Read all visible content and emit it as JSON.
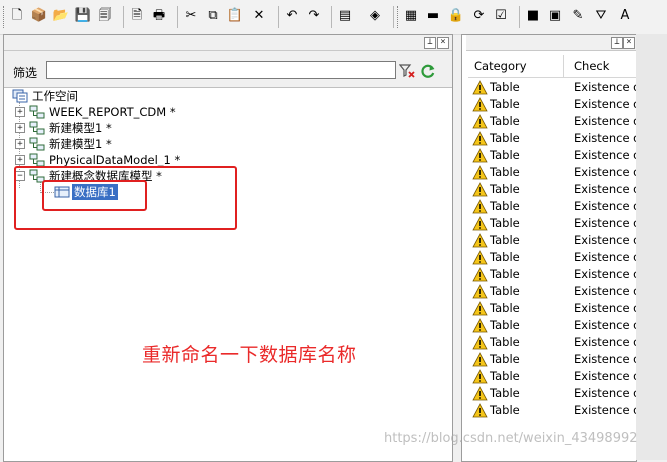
{
  "toolbar": {
    "buttons": [
      {
        "name": "new-icon",
        "glyph": "🗋"
      },
      {
        "name": "new-project-icon",
        "glyph": "📦"
      },
      {
        "name": "open-icon",
        "glyph": "📂"
      },
      {
        "name": "save-icon",
        "glyph": "💾"
      },
      {
        "name": "save-all-icon",
        "glyph": "🗐"
      },
      {
        "name": "print-preview-icon",
        "glyph": "🗎"
      },
      {
        "name": "print-icon",
        "glyph": "🖶"
      },
      {
        "name": "cut-icon",
        "glyph": "✂"
      },
      {
        "name": "copy-icon",
        "glyph": "⧉"
      },
      {
        "name": "paste-icon",
        "glyph": "📋"
      },
      {
        "name": "delete-icon",
        "glyph": "✕"
      },
      {
        "name": "undo-icon",
        "glyph": "↶"
      },
      {
        "name": "redo-icon",
        "glyph": "↷"
      },
      {
        "name": "properties-icon",
        "glyph": "▤"
      },
      {
        "name": "model-check-icon",
        "glyph": "◈"
      },
      {
        "name": "package-icon",
        "glyph": "▦"
      },
      {
        "name": "folder-icon",
        "glyph": "▬"
      },
      {
        "name": "lock-icon",
        "glyph": "🔒"
      },
      {
        "name": "refresh-diagram-icon",
        "glyph": "⟳"
      },
      {
        "name": "check-list-icon",
        "glyph": "☑"
      },
      {
        "name": "shape-icon",
        "glyph": "■"
      },
      {
        "name": "image-icon",
        "glyph": "▣"
      },
      {
        "name": "pen-icon",
        "glyph": "✎"
      },
      {
        "name": "paint-icon",
        "glyph": "⛛"
      },
      {
        "name": "text-format-icon",
        "glyph": "A"
      }
    ]
  },
  "left_panel": {
    "filter_label": "筛选",
    "filter_value": "",
    "tree": {
      "root_label": "工作空间",
      "items": [
        {
          "label": "WEEK_REPORT_CDM *",
          "expander": "+"
        },
        {
          "label": "新建模型1 *",
          "expander": "+"
        },
        {
          "label": "新建模型1 *",
          "expander": "+"
        },
        {
          "label": "PhysicalDataModel_1 *",
          "expander": "+"
        },
        {
          "label": "新建概念数据库模型 *",
          "expander": "−"
        }
      ],
      "child_label": "数据库1"
    },
    "annotation": "重新命名一下数据库名称"
  },
  "right_panel": {
    "columns": [
      "Category",
      "Check"
    ],
    "rows": [
      {
        "category": "Table",
        "check": "Existence of"
      },
      {
        "category": "Table",
        "check": "Existence of"
      },
      {
        "category": "Table",
        "check": "Existence of"
      },
      {
        "category": "Table",
        "check": "Existence of"
      },
      {
        "category": "Table",
        "check": "Existence of"
      },
      {
        "category": "Table",
        "check": "Existence of"
      },
      {
        "category": "Table",
        "check": "Existence of"
      },
      {
        "category": "Table",
        "check": "Existence of"
      },
      {
        "category": "Table",
        "check": "Existence of"
      },
      {
        "category": "Table",
        "check": "Existence of"
      },
      {
        "category": "Table",
        "check": "Existence of"
      },
      {
        "category": "Table",
        "check": "Existence of"
      },
      {
        "category": "Table",
        "check": "Existence of"
      },
      {
        "category": "Table",
        "check": "Existence of"
      },
      {
        "category": "Table",
        "check": "Existence of"
      },
      {
        "category": "Table",
        "check": "Existence of"
      },
      {
        "category": "Table",
        "check": "Existence of"
      },
      {
        "category": "Table",
        "check": "Existence of"
      },
      {
        "category": "Table",
        "check": "Existence of"
      },
      {
        "category": "Table",
        "check": "Existence of"
      }
    ]
  },
  "watermark": "https://blog.csdn.net/weixin_43498992",
  "colors": {
    "annotation_red": "#e02020",
    "selection_blue": "#3a6fc4",
    "warning_yellow": "#f5c518"
  }
}
